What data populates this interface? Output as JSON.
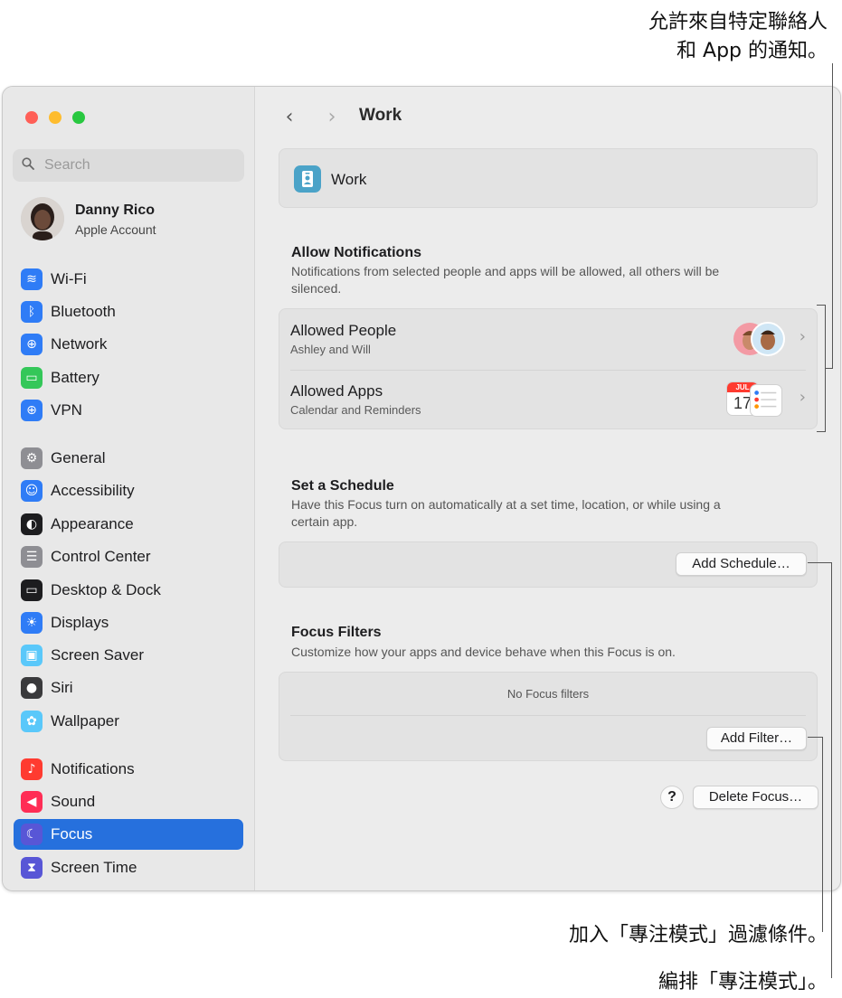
{
  "callouts": {
    "top_line1": "允許來自特定聯絡人",
    "top_line2": "和 App 的通知。",
    "filter": "加入「專注模式」過濾條件。",
    "schedule": "編排「專注模式」。"
  },
  "search": {
    "placeholder": "Search"
  },
  "account": {
    "name": "Danny Rico",
    "subtitle": "Apple Account"
  },
  "sidebar": {
    "items": [
      {
        "label": "Wi-Fi",
        "icon": "wifi-icon",
        "color": "#2f7cf6"
      },
      {
        "label": "Bluetooth",
        "icon": "bluetooth-icon",
        "color": "#2f7cf6"
      },
      {
        "label": "Network",
        "icon": "globe-icon",
        "color": "#2f7cf6"
      },
      {
        "label": "Battery",
        "icon": "battery-icon",
        "color": "#34c759"
      },
      {
        "label": "VPN",
        "icon": "vpn-globe-icon",
        "color": "#2f7cf6"
      },
      {
        "label": "General",
        "icon": "gear-icon",
        "color": "#8e8e93"
      },
      {
        "label": "Accessibility",
        "icon": "accessibility-icon",
        "color": "#2f7cf6"
      },
      {
        "label": "Appearance",
        "icon": "appearance-icon",
        "color": "#1d1d1f"
      },
      {
        "label": "Control Center",
        "icon": "control-center-icon",
        "color": "#8e8e93"
      },
      {
        "label": "Desktop & Dock",
        "icon": "dock-icon",
        "color": "#1d1d1f"
      },
      {
        "label": "Displays",
        "icon": "sun-icon",
        "color": "#2f7cf6"
      },
      {
        "label": "Screen Saver",
        "icon": "screen-saver-icon",
        "color": "#5ac8fa"
      },
      {
        "label": "Siri",
        "icon": "siri-icon",
        "color": "#3a3a3c"
      },
      {
        "label": "Wallpaper",
        "icon": "flower-icon",
        "color": "#5ac8fa"
      },
      {
        "label": "Notifications",
        "icon": "bell-icon",
        "color": "#ff3b30"
      },
      {
        "label": "Sound",
        "icon": "speaker-icon",
        "color": "#ff2d55"
      },
      {
        "label": "Focus",
        "icon": "moon-icon",
        "color": "#5856d6"
      },
      {
        "label": "Screen Time",
        "icon": "hourglass-icon",
        "color": "#5856d6"
      }
    ],
    "selected": "Focus"
  },
  "header": {
    "title": "Work"
  },
  "focus": {
    "name": "Work"
  },
  "allow": {
    "title": "Allow Notifications",
    "desc": "Notifications from selected people and apps will be allowed, all others will be silenced.",
    "people_title": "Allowed People",
    "people_sub": "Ashley and Will",
    "apps_title": "Allowed Apps",
    "apps_sub": "Calendar and Reminders",
    "calendar_month": "JUL",
    "calendar_day": "17"
  },
  "schedule": {
    "title": "Set a Schedule",
    "desc": "Have this Focus turn on automatically at a set time, location, or while using a certain app.",
    "add_button": "Add Schedule…"
  },
  "filters": {
    "title": "Focus Filters",
    "desc": "Customize how your apps and device behave when this Focus is on.",
    "empty": "No Focus filters",
    "add_button": "Add Filter…"
  },
  "footer": {
    "help": "?",
    "delete_button": "Delete Focus…"
  }
}
